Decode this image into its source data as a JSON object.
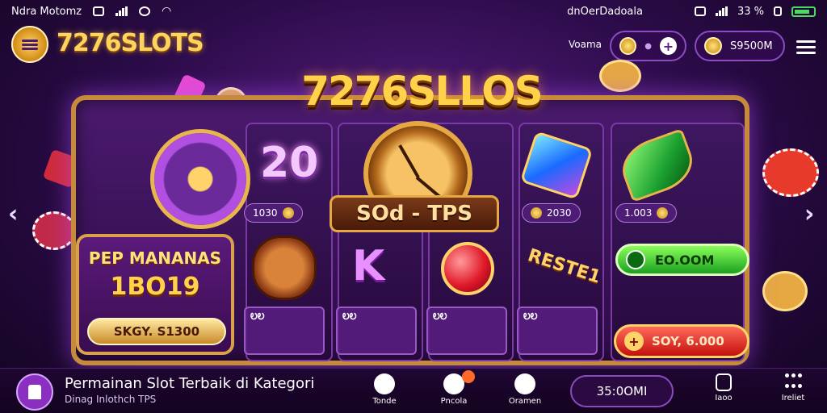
{
  "status_bar": {
    "left_text": "Ndra Motomz",
    "right_text": "dnOerDadoala",
    "battery_pct": "33 %"
  },
  "header": {
    "brand": "7276SLOTS",
    "player_label": "Voama",
    "balance": "S9500M"
  },
  "game": {
    "logo": "7276SLLOS",
    "big_number": "20",
    "reel_values": [
      "1030",
      "2030",
      "1.003"
    ],
    "banner": "SOd - TPS",
    "promo_title": "PEP MANANAS",
    "promo_number": "1BO19",
    "promo_button": "SKGY. S1300",
    "tile_labels": [
      "ᎧᎧ",
      "ᎧᎧ",
      "ᎧᎧ",
      "ᎧᎧ"
    ],
    "ribbon": "RESTE1",
    "green_button": "EO.OOM",
    "red_button": "SOY, 6.000",
    "k_symbol": "K",
    "accent": "#c58a3a"
  },
  "bottom_bar": {
    "title": "Permainan Slot Terbaik di Kategori",
    "subtitle": "Dinag Inlothch TPS",
    "nav": [
      "Tonde",
      "Pncola",
      "Oramen",
      "Iaoo",
      "Ireliet"
    ],
    "balance": "35:0OMI"
  },
  "icons": [
    "menu-icon",
    "coin-icon",
    "plus-icon",
    "hamburger-icon",
    "chevron-left-icon",
    "chevron-right-icon",
    "home-icon",
    "grid-icon"
  ]
}
